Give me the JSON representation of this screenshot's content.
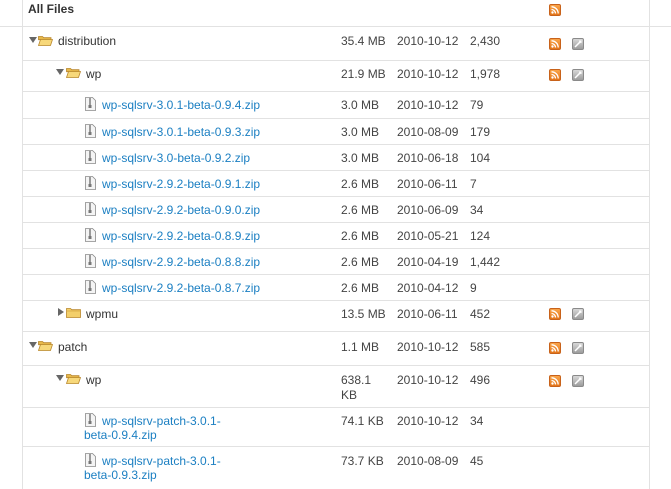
{
  "header": {
    "title": "All Files"
  },
  "icons": {
    "folder": "folder-open-icon",
    "folder_closed": "folder-icon",
    "file": "zip-file-icon",
    "rss": "rss-icon",
    "info": "info-icon"
  },
  "colors": {
    "link": "#1b7fc2",
    "border": "#e2e2e2",
    "rss": "#f28c28"
  },
  "rows": [
    {
      "name": "distribution",
      "size": "35.4 MB",
      "date": "2010-10-12",
      "downloads": "2,430"
    },
    {
      "name": "wp",
      "size": "21.9 MB",
      "date": "2010-10-12",
      "downloads": "1,978"
    },
    {
      "name": "wp-sqlsrv-3.0.1-beta-0.9.4.zip",
      "size": "3.0 MB",
      "date": "2010-10-12",
      "downloads": "79"
    },
    {
      "name": "wp-sqlsrv-3.0.1-beta-0.9.3.zip",
      "size": "3.0 MB",
      "date": "2010-08-09",
      "downloads": "179"
    },
    {
      "name": "wp-sqlsrv-3.0-beta-0.9.2.zip",
      "size": "3.0 MB",
      "date": "2010-06-18",
      "downloads": "104"
    },
    {
      "name": "wp-sqlsrv-2.9.2-beta-0.9.1.zip",
      "size": "2.6 MB",
      "date": "2010-06-11",
      "downloads": "7"
    },
    {
      "name": "wp-sqlsrv-2.9.2-beta-0.9.0.zip",
      "size": "2.6 MB",
      "date": "2010-06-09",
      "downloads": "34"
    },
    {
      "name": "wp-sqlsrv-2.9.2-beta-0.8.9.zip",
      "size": "2.6 MB",
      "date": "2010-05-21",
      "downloads": "124"
    },
    {
      "name": "wp-sqlsrv-2.9.2-beta-0.8.8.zip",
      "size": "2.6 MB",
      "date": "2010-04-19",
      "downloads": "1,442"
    },
    {
      "name": "wp-sqlsrv-2.9.2-beta-0.8.7.zip",
      "size": "2.6 MB",
      "date": "2010-04-12",
      "downloads": "9"
    },
    {
      "name": "wpmu",
      "size": "13.5 MB",
      "date": "2010-06-11",
      "downloads": "452"
    },
    {
      "name": "patch",
      "size": "1.1 MB",
      "date": "2010-10-12",
      "downloads": "585"
    },
    {
      "name": "wp",
      "size_line1": "638.1",
      "size_line2": "KB",
      "date": "2010-10-12",
      "downloads": "496"
    },
    {
      "name_line1": "wp-sqlsrv-patch-3.0.1-",
      "name_line2": "beta-0.9.4.zip",
      "size": "74.1 KB",
      "date": "2010-10-12",
      "downloads": "34"
    },
    {
      "name_line1": "wp-sqlsrv-patch-3.0.1-",
      "name_line2": "beta-0.9.3.zip",
      "size": "73.7 KB",
      "date": "2010-08-09",
      "downloads": "45"
    }
  ]
}
